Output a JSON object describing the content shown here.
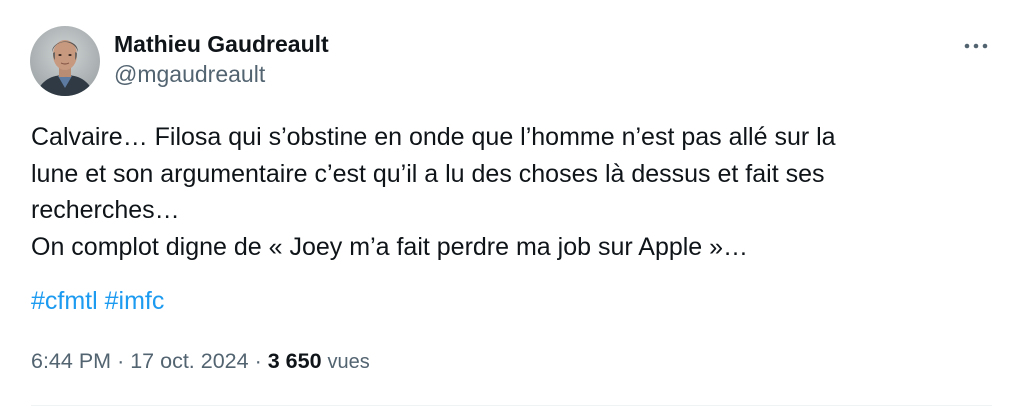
{
  "author": {
    "display_name": "Mathieu Gaudreault",
    "handle": "@mgaudreault"
  },
  "tweet": {
    "text": "Calvaire… Filosa qui s’obstine en onde que l’homme n’est pas allé sur la\nlune et son argumentaire c’est qu’il a lu des choses là dessus et fait ses\nrecherches…\nOn complot digne de « Joey m’a fait perdre ma job sur Apple »…",
    "hashtags": [
      "#cfmtl",
      "#imfc"
    ]
  },
  "meta": {
    "time": "6:44 PM",
    "separator": "·",
    "date": "17 oct. 2024",
    "views_count": "3 650",
    "views_label": "vues"
  },
  "icons": {
    "more": "more-horizontal-icon",
    "avatar": "avatar-photo"
  },
  "colors": {
    "text_primary": "#0f1419",
    "text_secondary": "#536471",
    "link": "#1d9bf0"
  }
}
